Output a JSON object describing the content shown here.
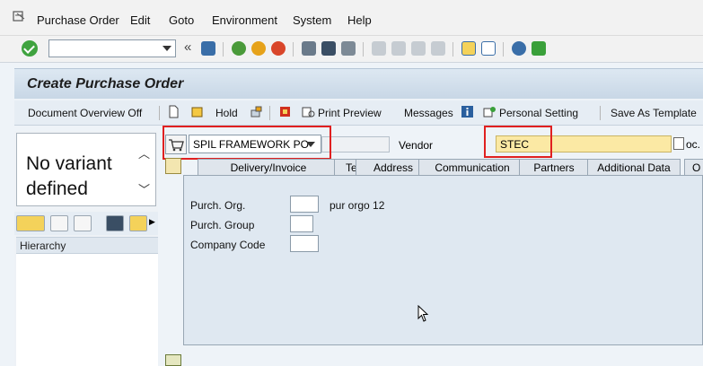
{
  "menu": [
    "Purchase Order",
    "Edit",
    "Goto",
    "Environment",
    "System",
    "Help"
  ],
  "title": "Create Purchase Order",
  "app_toolbar": {
    "document_overview": "Document Overview Off",
    "hold": "Hold",
    "print_preview": "Print Preview",
    "messages": "Messages",
    "personal_setting": "Personal Setting",
    "save_as_template": "Save As Template"
  },
  "variant": {
    "line1": "No variant",
    "line2": "defined"
  },
  "hierarchy_label": "Hierarchy",
  "header": {
    "doc_type": "SPIL FRAMEWORK PO",
    "vendor_label": "Vendor",
    "vendor_value": "STEC",
    "vendor_tail": "oc."
  },
  "tabs": [
    "Delivery/Invoice",
    "Texts",
    "Address",
    "Communication",
    "Partners",
    "Additional Data",
    "O"
  ],
  "fields": {
    "purch_org_label": "Purch. Org.",
    "purch_org_desc": "pur orgo 12",
    "purch_group_label": "Purch. Group",
    "company_code_label": "Company Code"
  },
  "colors": {
    "highlight": "#e02020",
    "vendor_bg": "#fbe9a4",
    "title_bg": "#c8d7e6"
  }
}
